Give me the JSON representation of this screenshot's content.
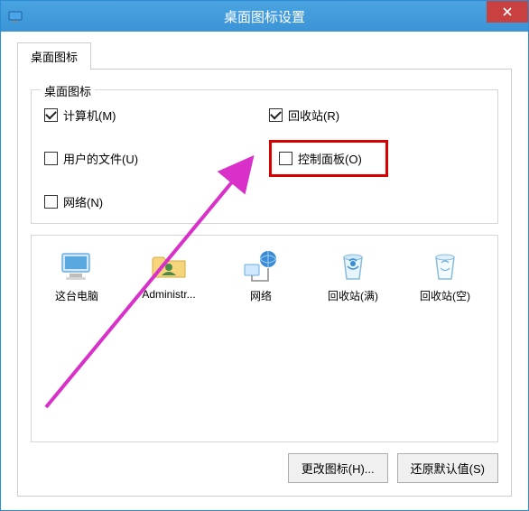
{
  "window": {
    "title": "桌面图标设置"
  },
  "tab": {
    "label": "桌面图标"
  },
  "group": {
    "title": "桌面图标"
  },
  "checks": {
    "computer": {
      "label": "计算机(M)",
      "checked": true
    },
    "recycle": {
      "label": "回收站(R)",
      "checked": true
    },
    "userfiles": {
      "label": "用户的文件(U)",
      "checked": false
    },
    "controlpanel": {
      "label": "控制面板(O)",
      "checked": false
    },
    "network": {
      "label": "网络(N)",
      "checked": false
    }
  },
  "icons": {
    "thispc": "这台电脑",
    "admin": "Administr...",
    "network": "网络",
    "recycle_full": "回收站(满)",
    "recycle_empty": "回收站(空)"
  },
  "buttons": {
    "change_icon": "更改图标(H)...",
    "restore_default": "还原默认值(S)"
  }
}
